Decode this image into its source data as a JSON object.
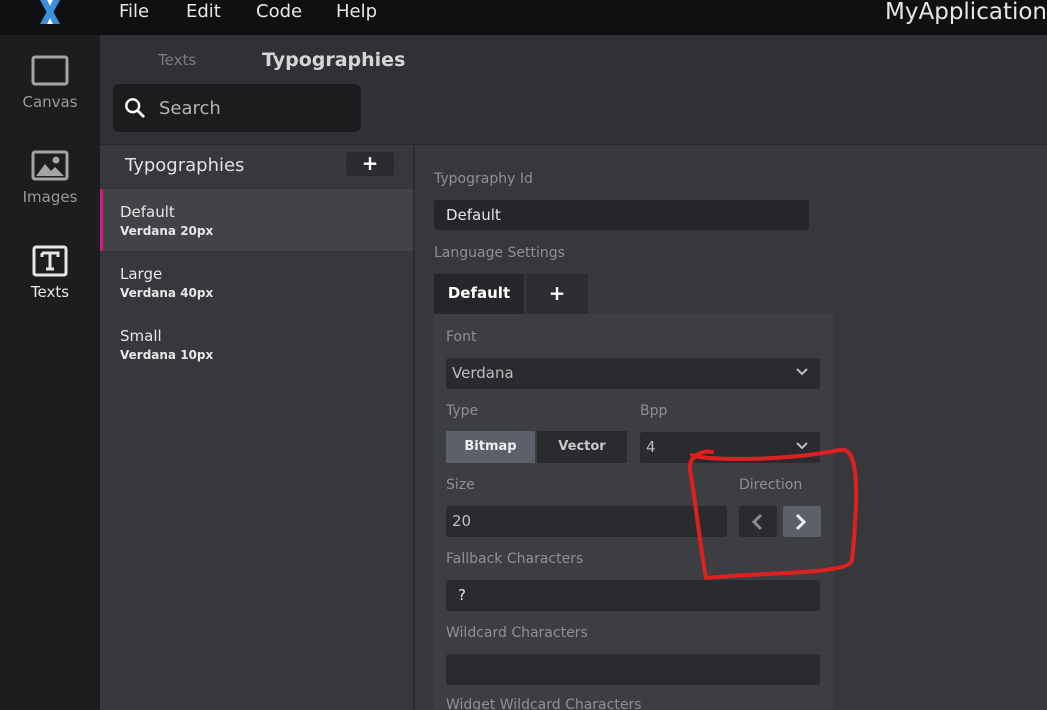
{
  "menu": {
    "items": [
      "File",
      "Edit",
      "Code",
      "Help"
    ],
    "app_title": "MyApplication"
  },
  "rail": {
    "items": [
      {
        "label": "Canvas"
      },
      {
        "label": "Images"
      },
      {
        "label": "Texts"
      }
    ]
  },
  "subheader": {
    "tabs": [
      "Texts",
      "Typographies"
    ],
    "search_placeholder": "Search"
  },
  "list": {
    "title": "Typographies",
    "add_label": "+",
    "items": [
      {
        "name": "Default",
        "meta": "Verdana  20px"
      },
      {
        "name": "Large",
        "meta": "Verdana  40px"
      },
      {
        "name": "Small",
        "meta": "Verdana  10px"
      }
    ]
  },
  "details": {
    "typography_id_label": "Typography Id",
    "typography_id_value": "Default",
    "language_settings_label": "Language Settings",
    "lang_tabs": {
      "active": "Default",
      "add": "+"
    },
    "font_label": "Font",
    "font_value": "Verdana",
    "type_label": "Type",
    "type_options": [
      "Bitmap",
      "Vector"
    ],
    "bpp_label": "Bpp",
    "bpp_value": "4",
    "size_label": "Size",
    "size_value": "20",
    "direction_label": "Direction",
    "fallback_label": "Fallback Characters",
    "fallback_value": "?",
    "wildcard_label": "Wildcard Characters",
    "wildcard_value": "",
    "widget_wildcard_label": "Widget Wildcard Characters"
  },
  "colors": {
    "accent": "#d81b7c",
    "annotation": "#e02020",
    "logo": "#3a8fd8"
  }
}
